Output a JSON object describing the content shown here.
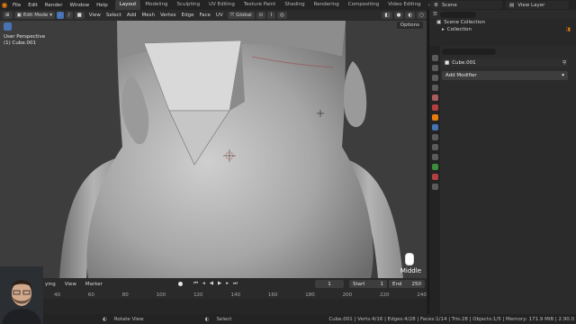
{
  "app": {
    "menu": [
      "File",
      "Edit",
      "Render",
      "Window",
      "Help"
    ],
    "tabs": [
      "Layout",
      "Modeling",
      "Sculpting",
      "UV Editing",
      "Texture Paint",
      "Shading",
      "Rendering",
      "Compositing",
      "Video Editing"
    ],
    "active_tab": "Layout",
    "scene": "Scene",
    "view_layer": "View Layer"
  },
  "viewport": {
    "mode": "Edit Mode",
    "menu": [
      "View",
      "Select",
      "Add",
      "Mesh",
      "Vertex",
      "Edge",
      "Face",
      "UV"
    ],
    "transform_orientation": "Global",
    "options_label": "Options",
    "info_line1": "User Perspective",
    "info_line2": "(1) Cube.001",
    "nav_hint": "Middle"
  },
  "timeline": {
    "menu": [
      "View",
      "Marker"
    ],
    "playback_fragment": "ying",
    "current_frame": "1",
    "start_label": "Start",
    "start_value": "1",
    "end_label": "End",
    "end_value": "250",
    "ruler": [
      "40",
      "60",
      "80",
      "100",
      "120",
      "140",
      "160",
      "180",
      "200",
      "220",
      "240"
    ]
  },
  "outliner": {
    "title": "Scene Collection",
    "items": [
      "Collection"
    ]
  },
  "properties": {
    "object_name": "Cube.001",
    "add_modifier": "Add Modifier"
  },
  "statusbar": {
    "hint1": "Rotate View",
    "hint2": "Select",
    "stats": "Cube.001 | Verts:4/16 | Edges:4/28 | Faces:1/14 | Tris:28 | Objects:1/5 | Memory: 171.9 MiB | 2.90.0"
  }
}
